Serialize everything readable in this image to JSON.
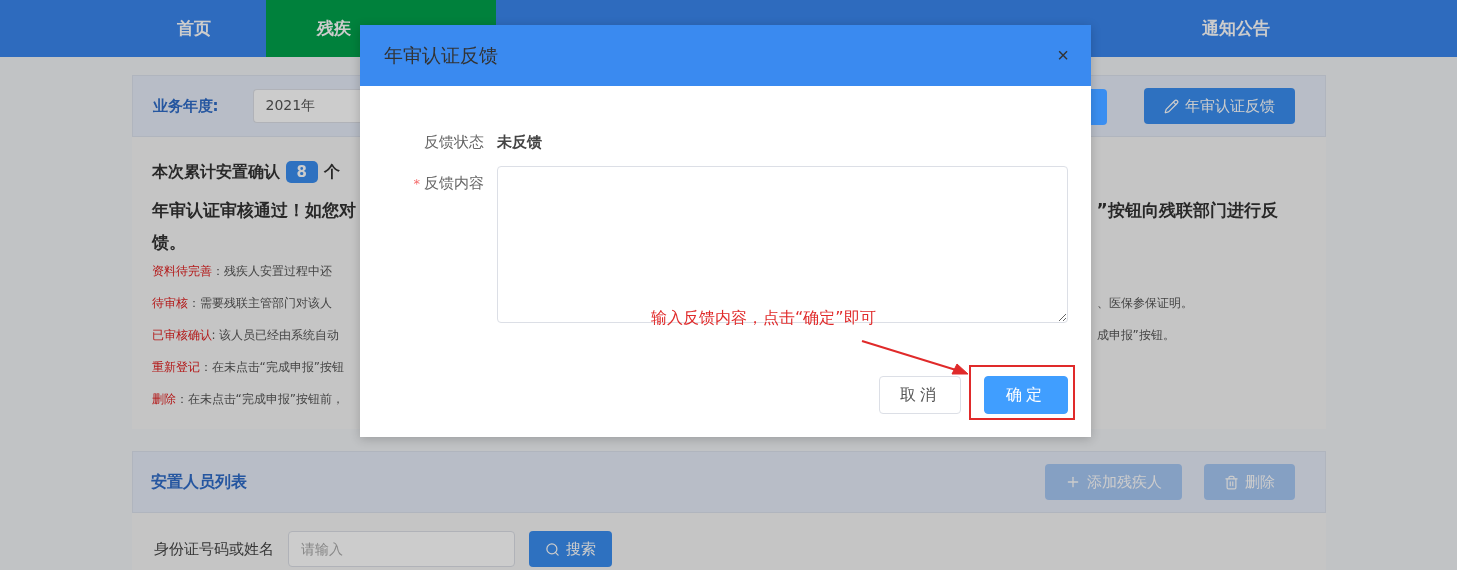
{
  "nav": {
    "items": [
      {
        "label": "首页",
        "selected": false
      },
      {
        "label": "残疾",
        "selected": true
      },
      {
        "label": "通知公告",
        "selected": false
      }
    ]
  },
  "toolbar": {
    "year_label": "业务年度:",
    "year_value": "2021年",
    "feedback_button": "年审认证反馈"
  },
  "summary": {
    "count_prefix": "本次累计安置确认",
    "count": "8",
    "count_suffix": "个",
    "notice_left": "年审认证审核通过！如您对",
    "notice_right": "”按钮向残联部门进行反",
    "notice_wrap": "馈。",
    "legend": [
      {
        "term": "资料待完善",
        "left": "：残疾人安置过程中还"
      },
      {
        "term": "待审核",
        "left": "：需要残联主管部门对该人",
        "right": "、医保参保证明。"
      },
      {
        "term": "已审核确认",
        "left": ": 该人员已经由系统自动",
        "right": "成申报”按钮。"
      },
      {
        "term": "重新登记",
        "left": "：在未点击“完成申报”按钮"
      },
      {
        "term": "删除",
        "left": "：在未点击“完成申报”按钮前，"
      }
    ]
  },
  "list": {
    "title": "安置人员列表",
    "add_button": "添加残疾人",
    "delete_button": "删除",
    "search_label": "身份证号码或姓名",
    "search_placeholder": "请输入",
    "search_button": "搜索"
  },
  "dialog": {
    "title": "年审认证反馈",
    "close": "×",
    "status_label": "反馈状态",
    "status_value": "未反馈",
    "required_mark": "*",
    "content_label": "反馈内容",
    "cancel": "取消",
    "confirm": "确定"
  },
  "annotation": {
    "text": "输入反馈内容，点击“确定”即可"
  }
}
